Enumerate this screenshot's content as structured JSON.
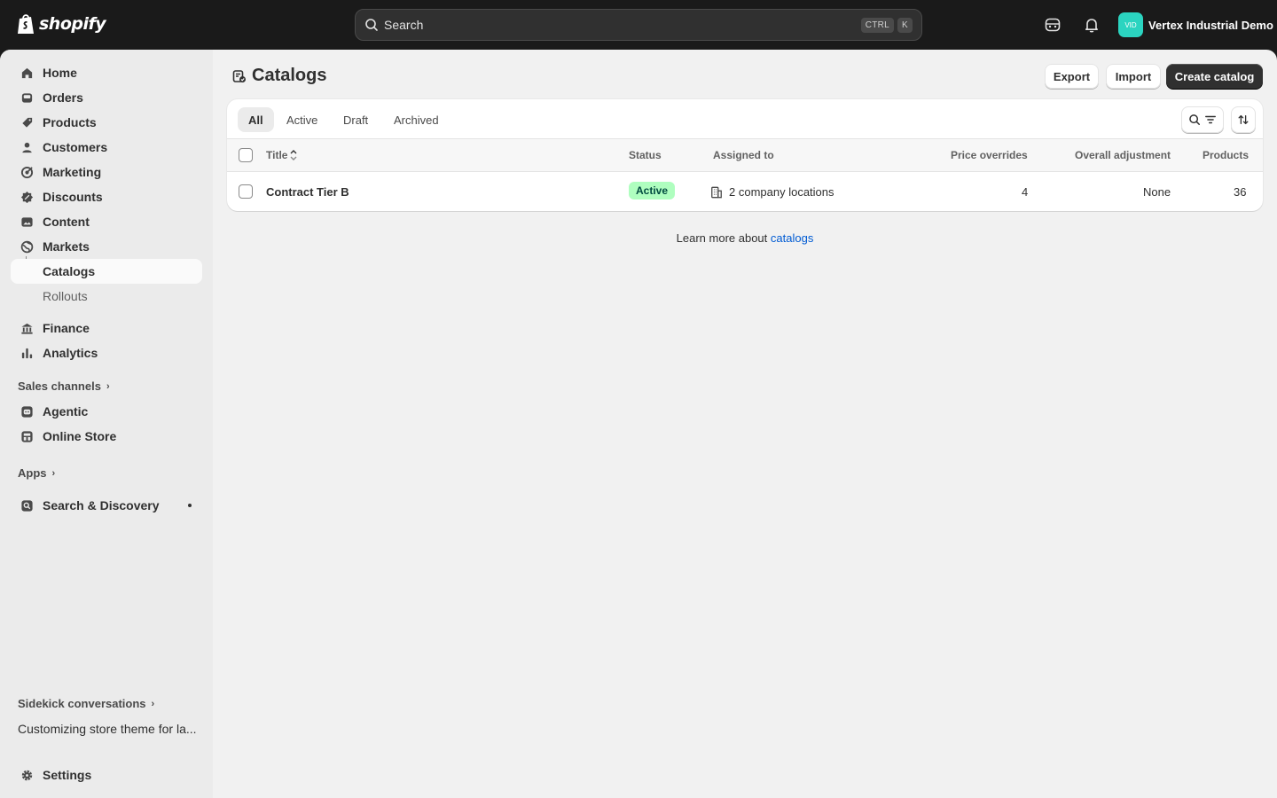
{
  "topbar": {
    "brand": "shopify",
    "search_placeholder": "Search",
    "shortcut_key1": "CTRL",
    "shortcut_key2": "K",
    "store_initials": "VID",
    "store_name": "Vertex Industrial Demo"
  },
  "sidebar": {
    "items": [
      {
        "label": "Home",
        "icon": "home-icon"
      },
      {
        "label": "Orders",
        "icon": "orders-icon"
      },
      {
        "label": "Products",
        "icon": "tag-icon"
      },
      {
        "label": "Customers",
        "icon": "person-icon"
      },
      {
        "label": "Marketing",
        "icon": "target-icon"
      },
      {
        "label": "Discounts",
        "icon": "discount-icon"
      },
      {
        "label": "Content",
        "icon": "image-icon"
      },
      {
        "label": "Markets",
        "icon": "globe-icon"
      }
    ],
    "sub_catalogs": "Catalogs",
    "sub_rollouts": "Rollouts",
    "finance": "Finance",
    "analytics": "Analytics",
    "sales_channels_label": "Sales channels",
    "agentic": "Agentic",
    "online_store": "Online Store",
    "apps_label": "Apps",
    "search_discovery": "Search & Discovery",
    "sidekick_label": "Sidekick conversations",
    "sidekick_item": "Customizing store theme for la...",
    "settings": "Settings"
  },
  "page": {
    "title": "Catalogs",
    "export": "Export",
    "import": "Import",
    "create": "Create catalog"
  },
  "tabs": [
    "All",
    "Active",
    "Draft",
    "Archived"
  ],
  "table": {
    "headers": {
      "title": "Title",
      "status": "Status",
      "assigned": "Assigned to",
      "price_overrides": "Price overrides",
      "overall_adjustment": "Overall adjustment",
      "products": "Products"
    },
    "rows": [
      {
        "title": "Contract Tier B",
        "status": "Active",
        "assigned": "2 company locations",
        "price_overrides": "4",
        "overall_adjustment": "None",
        "products": "36"
      }
    ]
  },
  "footer": {
    "learn_prefix": "Learn more about",
    "learn_link": "catalogs"
  },
  "colors": {
    "topbar": "#1a1a1a",
    "accent_link": "#005bd3",
    "badge_active_bg": "#affebf",
    "avatar": "#2bd4c0"
  }
}
